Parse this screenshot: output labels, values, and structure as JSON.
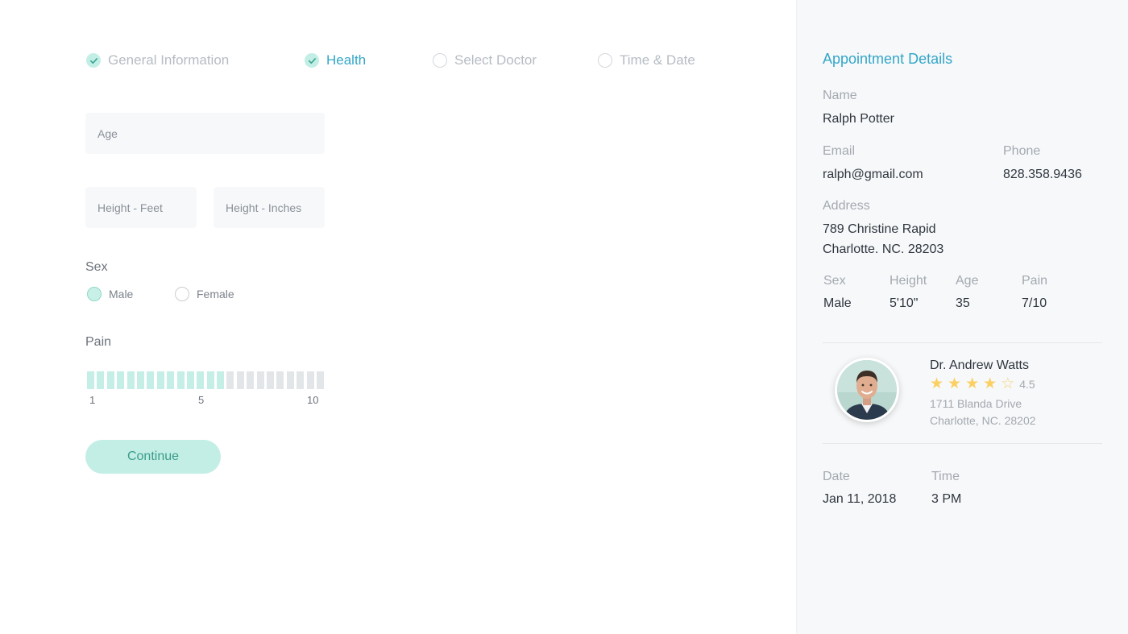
{
  "steps": [
    {
      "label": "General Information",
      "state": "done"
    },
    {
      "label": "Health",
      "state": "active"
    },
    {
      "label": "Select Doctor",
      "state": "pending"
    },
    {
      "label": "Time & Date",
      "state": "pending"
    }
  ],
  "form": {
    "age_placeholder": "Age",
    "height_feet_placeholder": "Height - Feet",
    "height_inches_placeholder": "Height - Inches",
    "sex_label": "Sex",
    "sex_options": [
      "Male",
      "Female"
    ],
    "sex_selected": "Male",
    "pain_label": "Pain",
    "pain_level_fraction": 0.6,
    "pain_ticks": [
      "1",
      "5",
      "10"
    ],
    "continue_label": "Continue"
  },
  "details": {
    "title": "Appointment Details",
    "name_label": "Name",
    "name": "Ralph Potter",
    "email_label": "Email",
    "email": "ralph@gmail.com",
    "phone_label": "Phone",
    "phone": "828.358.9436",
    "address_label": "Address",
    "address_line1": "789 Christine Rapid",
    "address_line2": "Charlotte. NC. 28203",
    "sex_label": "Sex",
    "sex": "Male",
    "height_label": "Height",
    "height": "5'10\"",
    "age_label": "Age",
    "age": "35",
    "pain_label": "Pain",
    "pain": "7/10",
    "doctor": {
      "name": "Dr. Andrew Watts",
      "rating": "4.5",
      "stars_filled": 4,
      "stars_total": 5,
      "address_line1": "1711 Blanda Drive",
      "address_line2": "Charlotte, NC. 28202"
    },
    "date_label": "Date",
    "date": "Jan 11, 2018",
    "time_label": "Time",
    "time": "3 PM"
  },
  "colors": {
    "accent": "#33a6c9",
    "mint": "#c3eee6",
    "star": "#fbd063",
    "panel_bg": "#f7f8f9"
  }
}
